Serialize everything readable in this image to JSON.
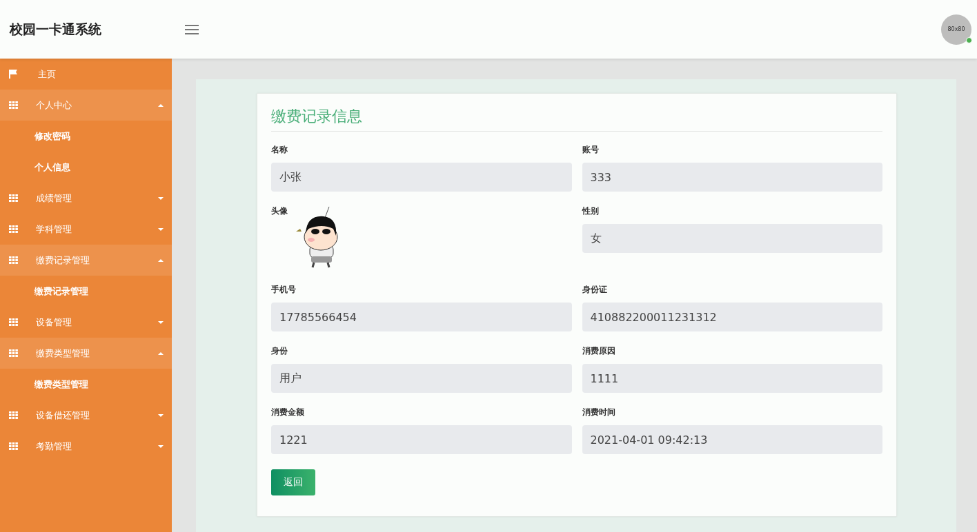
{
  "header": {
    "title": "校园一卡通系统",
    "avatar_text": "80x80"
  },
  "sidebar": {
    "items": [
      {
        "label": "主页",
        "kind": "home",
        "expanded": false
      },
      {
        "label": "个人中心",
        "kind": "group",
        "expanded": true,
        "children": [
          {
            "label": "修改密码"
          },
          {
            "label": "个人信息"
          }
        ]
      },
      {
        "label": "成绩管理",
        "kind": "group",
        "expanded": false
      },
      {
        "label": "学科管理",
        "kind": "group",
        "expanded": false
      },
      {
        "label": "缴费记录管理",
        "kind": "group",
        "expanded": true,
        "children": [
          {
            "label": "缴费记录管理"
          }
        ]
      },
      {
        "label": "设备管理",
        "kind": "group",
        "expanded": false
      },
      {
        "label": "缴费类型管理",
        "kind": "group",
        "expanded": true,
        "children": [
          {
            "label": "缴费类型管理"
          }
        ]
      },
      {
        "label": "设备借还管理",
        "kind": "group",
        "expanded": false
      },
      {
        "label": "考勤管理",
        "kind": "group",
        "expanded": false
      }
    ]
  },
  "form": {
    "title": "缴费记录信息",
    "fields": [
      {
        "label": "名称",
        "kind": "text",
        "value": "小张"
      },
      {
        "label": "账号",
        "kind": "text",
        "value": "333"
      },
      {
        "label": "头像",
        "kind": "image"
      },
      {
        "label": "性别",
        "kind": "text",
        "value": "女"
      },
      {
        "label": "手机号",
        "kind": "text",
        "value": "17785566454"
      },
      {
        "label": "身份证",
        "kind": "text",
        "value": "410882200011231312"
      },
      {
        "label": "身份",
        "kind": "text",
        "value": "用户"
      },
      {
        "label": "消费原因",
        "kind": "text",
        "value": "1111"
      },
      {
        "label": "消费金额",
        "kind": "text",
        "value": "1221"
      },
      {
        "label": "消费时间",
        "kind": "text",
        "value": "2021-04-01 09:42:13"
      }
    ],
    "back_button": "返回"
  }
}
